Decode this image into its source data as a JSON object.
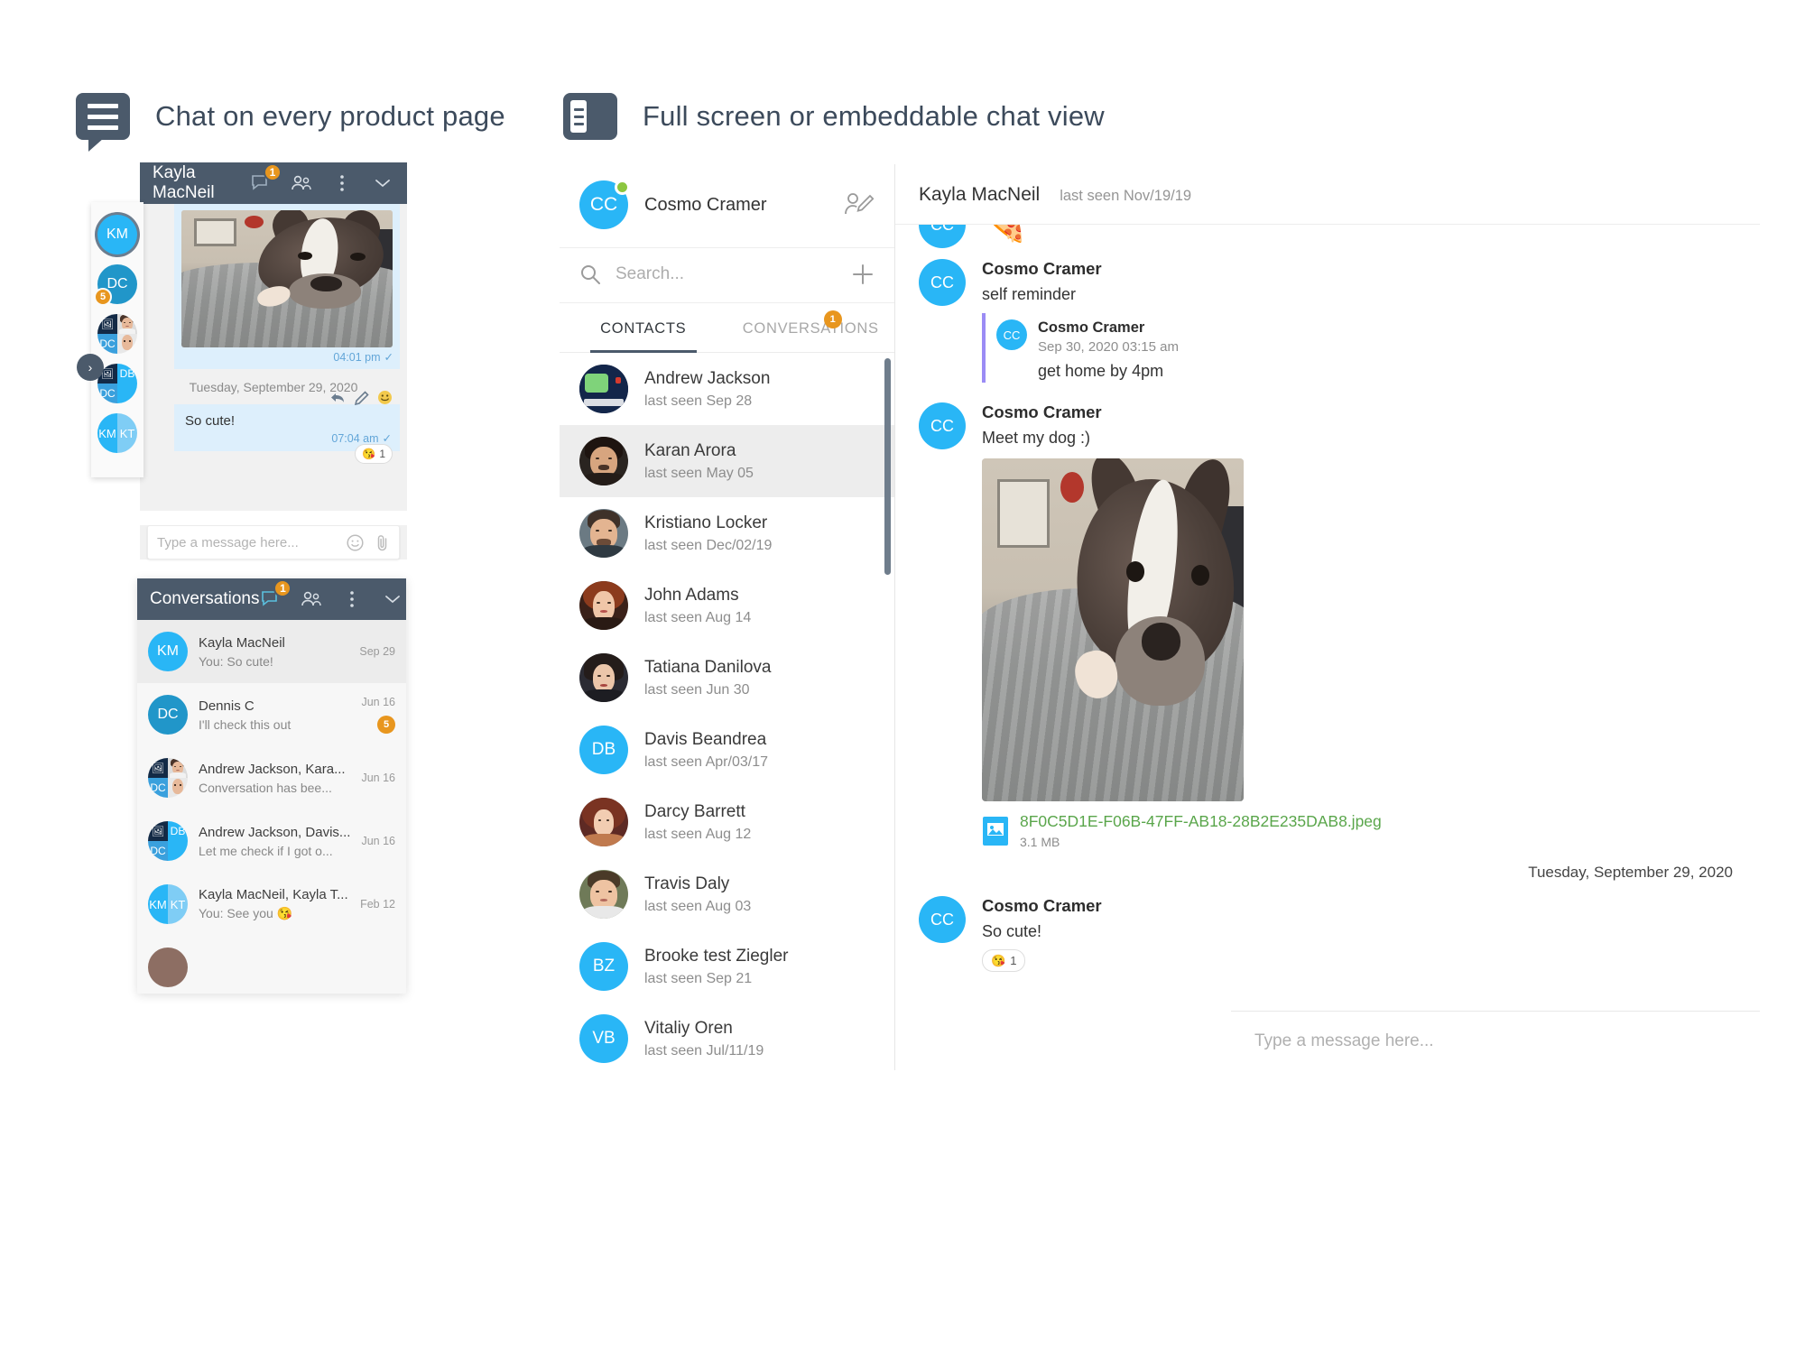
{
  "sections": [
    {
      "id": "left",
      "icon": "chat-bubble-icon",
      "title": "Chat on every product page"
    },
    {
      "id": "right",
      "icon": "panel-layout-icon",
      "title": "Full screen or embeddable chat view"
    }
  ],
  "product_widget": {
    "header": {
      "title": "Kayla MacNeil",
      "unread_badge": "1",
      "icons": [
        "chat-bubble-icon",
        "people-icon",
        "more-vertical-icon",
        "chevron-down-icon"
      ]
    },
    "rail": {
      "expand_arrow": "›",
      "avatars": [
        {
          "name": "Kayla MacNeil",
          "initials": "KM",
          "type": "initials",
          "color": "#29b6f6",
          "selected": true,
          "badge": null
        },
        {
          "name": "Dennis C",
          "initials": "DC",
          "type": "initials",
          "color": "#2196c9",
          "selected": false,
          "badge": "5"
        },
        {
          "name": "Andrew Jackson, Karan Arora",
          "type": "quad",
          "initials": "DC",
          "color": "#3aa0dd",
          "selected": false,
          "badge": null
        },
        {
          "name": "Andrew Jackson, Davis Beandrea",
          "type": "quad",
          "initials": "DB",
          "color": "#29b6f6",
          "selected": false,
          "badge": null
        },
        {
          "name": "Kayla MacNeil, Kayla T",
          "type": "half",
          "left_initials": "KM",
          "right_initials": "KT",
          "color": "#29b6f6",
          "selected": false,
          "badge": null
        }
      ]
    },
    "messages": [
      {
        "kind": "image",
        "time": "04:01 pm",
        "status": "✓",
        "alt": "dog-photo"
      },
      {
        "kind": "day-separator",
        "text": "Tuesday, September 29, 2020"
      },
      {
        "kind": "text",
        "text": "So cute!",
        "time": "07:04 am",
        "status": "✓",
        "actions": [
          "reply-icon",
          "edit-icon",
          "emoji-icon"
        ],
        "reaction": {
          "emoji": "😘",
          "count": "1"
        }
      }
    ],
    "composer": {
      "placeholder": "Type a message here...",
      "icons": [
        "emoji-icon",
        "attach-icon"
      ]
    }
  },
  "conversations_widget": {
    "header": {
      "title": "Conversations",
      "unread_badge": "1",
      "icons": [
        "chat-bubble-icon",
        "people-icon",
        "more-vertical-icon",
        "chevron-down-icon"
      ]
    },
    "rows": [
      {
        "name": "Kayla MacNeil",
        "preview": "You: So cute!",
        "date": "Sep 29",
        "badge": null,
        "active": true,
        "avatar": {
          "type": "initials",
          "initials": "KM",
          "color": "#29b6f6"
        }
      },
      {
        "name": "Dennis C",
        "preview": "I'll check this out",
        "date": "Jun 16",
        "badge": "5",
        "active": false,
        "avatar": {
          "type": "initials",
          "initials": "DC",
          "color": "#2196c9"
        }
      },
      {
        "name": "Andrew Jackson, Kara...",
        "preview": "Conversation has bee...",
        "date": "Jun 16",
        "badge": null,
        "active": false,
        "avatar": {
          "type": "quad",
          "initials": "DC",
          "color": "#3aa0dd"
        }
      },
      {
        "name": "Andrew Jackson, Davis...",
        "preview": "Let me check if I got o...",
        "date": "Jun 16",
        "badge": null,
        "active": false,
        "avatar": {
          "type": "quad",
          "initials": "DB",
          "color": "#29b6f6"
        }
      },
      {
        "name": "Kayla MacNeil, Kayla T...",
        "preview": "You: See you 😘",
        "date": "Feb 12",
        "badge": null,
        "active": false,
        "avatar": {
          "type": "half",
          "left_initials": "KM",
          "right_initials": "KT",
          "color": "#29b6f6"
        }
      }
    ]
  },
  "app": {
    "me": {
      "initials": "CC",
      "name": "Cosmo Cramer",
      "status": "online",
      "status_color": "#8cc63f",
      "compose_icon": "compose-pencil-icon"
    },
    "search": {
      "placeholder": "Search...",
      "icon": "search-icon",
      "add_icon": "plus-icon"
    },
    "tabs": [
      {
        "label": "CONTACTS",
        "active": true,
        "badge": null
      },
      {
        "label": "CONVERSATIONS",
        "active": false,
        "badge": "1"
      }
    ],
    "contacts": [
      {
        "name": "Andrew Jackson",
        "seen": "last seen Sep 28",
        "selected": false,
        "avatar": {
          "type": "photo",
          "variant": "andrew",
          "bg": "#1b2a4a"
        }
      },
      {
        "name": "Karan Arora",
        "seen": "last seen May 05",
        "selected": true,
        "avatar": {
          "type": "photo",
          "variant": "karan",
          "bg": "#2a2420"
        }
      },
      {
        "name": "Kristiano Locker",
        "seen": "last seen Dec/02/19",
        "selected": false,
        "avatar": {
          "type": "photo",
          "variant": "kristiano",
          "bg": "#55646f"
        }
      },
      {
        "name": "John Adams",
        "seen": "last seen Aug 14",
        "selected": false,
        "avatar": {
          "type": "photo",
          "variant": "john",
          "bg": "#3b2119"
        }
      },
      {
        "name": "Tatiana Danilova",
        "seen": "last seen Jun 30",
        "selected": false,
        "avatar": {
          "type": "photo",
          "variant": "tatiana",
          "bg": "#2b2b33"
        }
      },
      {
        "name": "Davis Beandrea",
        "seen": "last seen Apr/03/17",
        "selected": false,
        "avatar": {
          "type": "initials",
          "initials": "DB",
          "color": "#29b6f6"
        }
      },
      {
        "name": "Darcy Barrett",
        "seen": "last seen Aug 12",
        "selected": false,
        "avatar": {
          "type": "photo",
          "variant": "darcy",
          "bg": "#5e2a24"
        }
      },
      {
        "name": "Travis Daly",
        "seen": "last seen Aug 03",
        "selected": false,
        "avatar": {
          "type": "photo",
          "variant": "travis",
          "bg": "#3f4a33"
        }
      },
      {
        "name": "Brooke test Ziegler",
        "seen": "last seen Sep 21",
        "selected": false,
        "avatar": {
          "type": "initials",
          "initials": "BZ",
          "color": "#29b6f6"
        }
      },
      {
        "name": "Vitaliy Oren",
        "seen": "last seen Jul/11/19",
        "selected": false,
        "avatar": {
          "type": "initials",
          "initials": "VB",
          "color": "#29b6f6"
        }
      }
    ],
    "chat": {
      "header": {
        "name": "Kayla MacNeil",
        "last_seen": "last seen Nov/19/19"
      },
      "messages": [
        {
          "kind": "emoji-only",
          "avatar_initials": "CC",
          "emoji": "🍕"
        },
        {
          "kind": "quoted",
          "avatar_initials": "CC",
          "name": "Cosmo Cramer",
          "text": "self reminder",
          "quote": {
            "avatar_initials": "CC",
            "name": "Cosmo Cramer",
            "time": "Sep 30, 2020 03:15 am",
            "text": "get home by 4pm"
          }
        },
        {
          "kind": "image-attachment",
          "avatar_initials": "CC",
          "name": "Cosmo Cramer",
          "text": "Meet my dog :)",
          "file": {
            "name": "8F0C5D1E-F06B-47FF-AB18-28B2E235DAB8.jpeg",
            "size": "3.1 MB",
            "icon": "image-file-icon",
            "color": "#5aa64b"
          }
        },
        {
          "kind": "day-separator",
          "text": "Tuesday, September 29, 2020"
        },
        {
          "kind": "text",
          "avatar_initials": "CC",
          "name": "Cosmo Cramer",
          "text": "So cute!",
          "reaction": {
            "emoji": "😘",
            "count": "1"
          }
        }
      ],
      "composer": {
        "placeholder": "Type a message here..."
      }
    }
  }
}
